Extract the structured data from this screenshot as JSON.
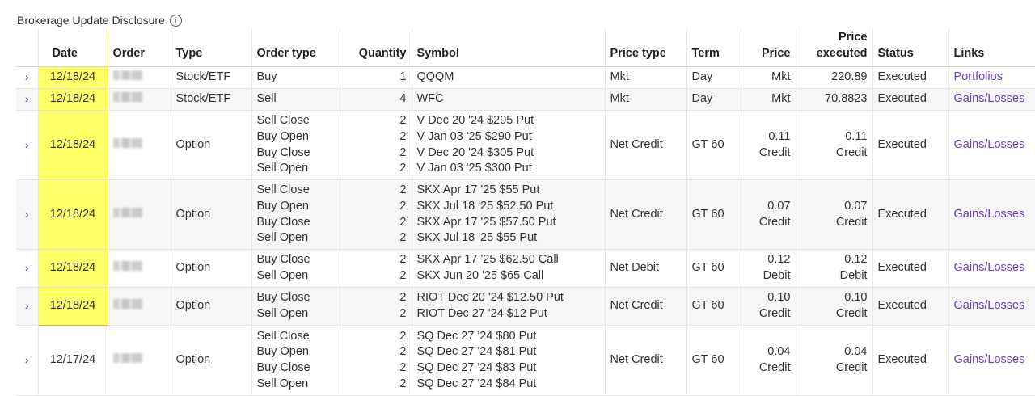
{
  "title": "Brokerage Update Disclosure",
  "info_icon": "i",
  "columns": {
    "date": "Date",
    "order": "Order",
    "type": "Type",
    "order_type": "Order type",
    "quantity": "Quantity",
    "symbol": "Symbol",
    "price_type": "Price type",
    "term": "Term",
    "price": "Price",
    "price_executed_1": "Price",
    "price_executed_2": "executed",
    "status": "Status",
    "links": "Links"
  },
  "expand_glyph": "›",
  "rows": [
    {
      "date": "12/18/24",
      "type": "Stock/ETF",
      "order_types": [
        "Buy"
      ],
      "quantities": [
        "1"
      ],
      "symbols": [
        "QQQM"
      ],
      "price_type": "Mkt",
      "term": "Day",
      "price": [
        "Mkt"
      ],
      "price_executed": [
        "220.89"
      ],
      "status": "Executed",
      "link": "Portfolios"
    },
    {
      "date": "12/18/24",
      "type": "Stock/ETF",
      "order_types": [
        "Sell"
      ],
      "quantities": [
        "4"
      ],
      "symbols": [
        "WFC"
      ],
      "price_type": "Mkt",
      "term": "Day",
      "price": [
        "Mkt"
      ],
      "price_executed": [
        "70.8823"
      ],
      "status": "Executed",
      "link": "Gains/Losses"
    },
    {
      "date": "12/18/24",
      "type": "Option",
      "order_types": [
        "Sell Close",
        "Buy Open",
        "Buy Close",
        "Sell Open"
      ],
      "quantities": [
        "2",
        "2",
        "2",
        "2"
      ],
      "symbols": [
        "V Dec 20 '24 $295 Put",
        "V Jan 03 '25 $290 Put",
        "V Dec 20 '24 $305 Put",
        "V Jan 03 '25 $300 Put"
      ],
      "price_type": "Net Credit",
      "term": "GT 60",
      "price": [
        "0.11",
        "Credit"
      ],
      "price_executed": [
        "0.11",
        "Credit"
      ],
      "status": "Executed",
      "link": "Gains/Losses"
    },
    {
      "date": "12/18/24",
      "type": "Option",
      "order_types": [
        "Sell Close",
        "Buy Open",
        "Buy Close",
        "Sell Open"
      ],
      "quantities": [
        "2",
        "2",
        "2",
        "2"
      ],
      "symbols": [
        "SKX Apr 17 '25 $55 Put",
        "SKX Jul 18 '25 $52.50 Put",
        "SKX Apr 17 '25 $57.50 Put",
        "SKX Jul 18 '25 $55 Put"
      ],
      "price_type": "Net Credit",
      "term": "GT 60",
      "price": [
        "0.07",
        "Credit"
      ],
      "price_executed": [
        "0.07",
        "Credit"
      ],
      "status": "Executed",
      "link": "Gains/Losses"
    },
    {
      "date": "12/18/24",
      "type": "Option",
      "order_types": [
        "Buy Close",
        "Sell Open"
      ],
      "quantities": [
        "2",
        "2"
      ],
      "symbols": [
        "SKX Apr 17 '25 $62.50 Call",
        "SKX Jun 20 '25 $65 Call"
      ],
      "price_type": "Net Debit",
      "term": "GT 60",
      "price": [
        "0.12",
        "Debit"
      ],
      "price_executed": [
        "0.12",
        "Debit"
      ],
      "status": "Executed",
      "link": "Gains/Losses"
    },
    {
      "date": "12/18/24",
      "type": "Option",
      "order_types": [
        "Buy Close",
        "Sell Open"
      ],
      "quantities": [
        "2",
        "2"
      ],
      "symbols": [
        "RIOT Dec 20 '24 $12.50 Put",
        "RIOT Dec 27 '24 $12 Put"
      ],
      "price_type": "Net Credit",
      "term": "GT 60",
      "price": [
        "0.10",
        "Credit"
      ],
      "price_executed": [
        "0.10",
        "Credit"
      ],
      "status": "Executed",
      "link": "Gains/Losses"
    },
    {
      "date": "12/17/24",
      "type": "Option",
      "order_types": [
        "Sell Close",
        "Buy Open",
        "Buy Close",
        "Sell Open"
      ],
      "quantities": [
        "2",
        "2",
        "2",
        "2"
      ],
      "symbols": [
        "SQ Dec 27 '24 $80 Put",
        "SQ Dec 27 '24 $81 Put",
        "SQ Dec 27 '24 $83 Put",
        "SQ Dec 27 '24 $84 Put"
      ],
      "price_type": "Net Credit",
      "term": "GT 60",
      "price": [
        "0.04",
        "Credit"
      ],
      "price_executed": [
        "0.04",
        "Credit"
      ],
      "status": "Executed",
      "link": "Gains/Losses"
    }
  ]
}
